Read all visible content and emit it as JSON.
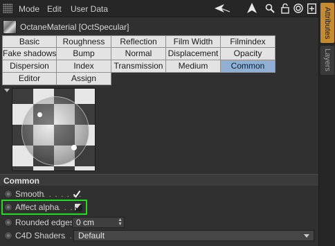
{
  "menubar": {
    "items": [
      "Mode",
      "Edit",
      "User Data"
    ],
    "tools": [
      "back-arrow-icon",
      "cursor-arrow-icon",
      "search-icon",
      "lock-icon",
      "target-icon",
      "add-panel-icon"
    ]
  },
  "material": {
    "title": "OctaneMaterial [OctSpecular]"
  },
  "tabs": {
    "rows": [
      [
        "Basic",
        "Roughness",
        "Reflection",
        "Film Width",
        "Filmindex"
      ],
      [
        "Fake shadows",
        "Bump",
        "Normal",
        "Displacement",
        "Opacity"
      ],
      [
        "Dispersion",
        "Index",
        "Transmission",
        "Medium",
        "Common"
      ],
      [
        "Editor",
        "Assign"
      ]
    ],
    "active": "Common"
  },
  "section": {
    "title": "Common"
  },
  "params": {
    "smooth": {
      "label": "Smooth",
      "dots": ". . . . . . .",
      "checked": true
    },
    "affect_alpha": {
      "label": "Affect alpha",
      "dots": ". . .",
      "checked": "indeterminate"
    },
    "rounded_edges": {
      "label": "Rounded edges",
      "value": "0 cm"
    },
    "c4d_shaders": {
      "label": "C4D Shaders",
      "dots": ". .",
      "value": "Default"
    }
  },
  "sidebar": {
    "tabs": [
      "Attributes",
      "Layers"
    ],
    "active": "Attributes"
  },
  "colors": {
    "active_tab": "#8fb0d4",
    "highlight": "#22dd22",
    "sidebar_active": "#c78a2c"
  }
}
